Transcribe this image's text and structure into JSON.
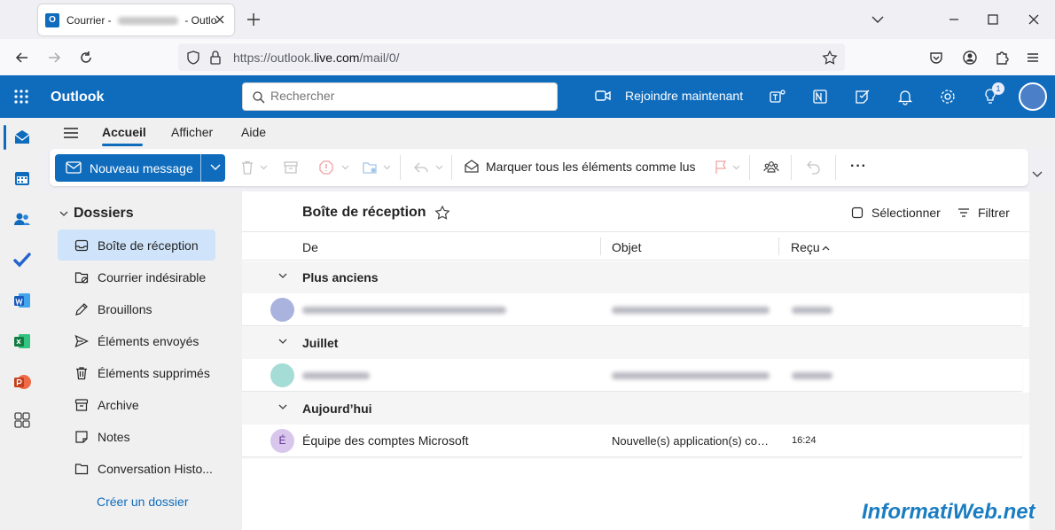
{
  "browser": {
    "tab_title_prefix": "Courrier - ",
    "tab_title_suffix": " - Outlook",
    "url_prefix": "https://outlook.",
    "url_domain": "live.com",
    "url_path": "/mail/0/"
  },
  "header": {
    "brand": "Outlook",
    "search_placeholder": "Rechercher",
    "join_label": "Rejoindre maintenant",
    "tips_badge": "1",
    "accent": "#0f6cbd"
  },
  "ribbon": {
    "tabs": [
      "Accueil",
      "Afficher",
      "Aide"
    ],
    "new_message": "Nouveau message",
    "mark_all_read": "Marquer tous les éléments comme lus",
    "more": "···"
  },
  "folders": {
    "heading": "Dossiers",
    "items": [
      {
        "label": "Boîte de réception",
        "icon": "inbox-icon"
      },
      {
        "label": "Courrier indésirable",
        "icon": "junk-icon"
      },
      {
        "label": "Brouillons",
        "icon": "pencil-icon"
      },
      {
        "label": "Éléments envoyés",
        "icon": "send-icon"
      },
      {
        "label": "Éléments supprimés",
        "icon": "trash-icon"
      },
      {
        "label": "Archive",
        "icon": "archive-icon"
      },
      {
        "label": "Notes",
        "icon": "note-icon"
      },
      {
        "label": "Conversation Histo...",
        "icon": "folder-icon"
      }
    ],
    "create": "Créer un dossier"
  },
  "list": {
    "title": "Boîte de réception",
    "select": "Sélectionner",
    "filter": "Filtrer",
    "columns": {
      "from": "De",
      "subject": "Objet",
      "received": "Reçu"
    },
    "groups": {
      "older": "Plus anciens",
      "july": "Juillet",
      "today": "Aujourd’hui"
    },
    "today_message": {
      "avatar": "É",
      "from": "Équipe des comptes Microsoft",
      "subject": "Nouvelle(s) application(s) connectée(s)",
      "time": "16:24"
    }
  },
  "watermark": "InformatiWeb.net"
}
